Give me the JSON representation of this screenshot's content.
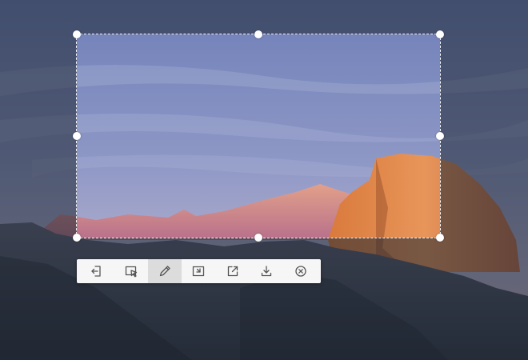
{
  "toolbar": {
    "active_tool": "pen",
    "tools": [
      {
        "name": "exit-icon"
      },
      {
        "name": "select-region-icon"
      },
      {
        "name": "pen-icon"
      },
      {
        "name": "pin-icon"
      },
      {
        "name": "share-icon"
      },
      {
        "name": "download-icon"
      },
      {
        "name": "close-icon"
      }
    ]
  },
  "colors": {
    "toolbar_bg": "#f6f6f6",
    "active_tool_bg": "#dcdcdc",
    "icon_stroke": "#555555",
    "selection_border": "#ffffff"
  }
}
